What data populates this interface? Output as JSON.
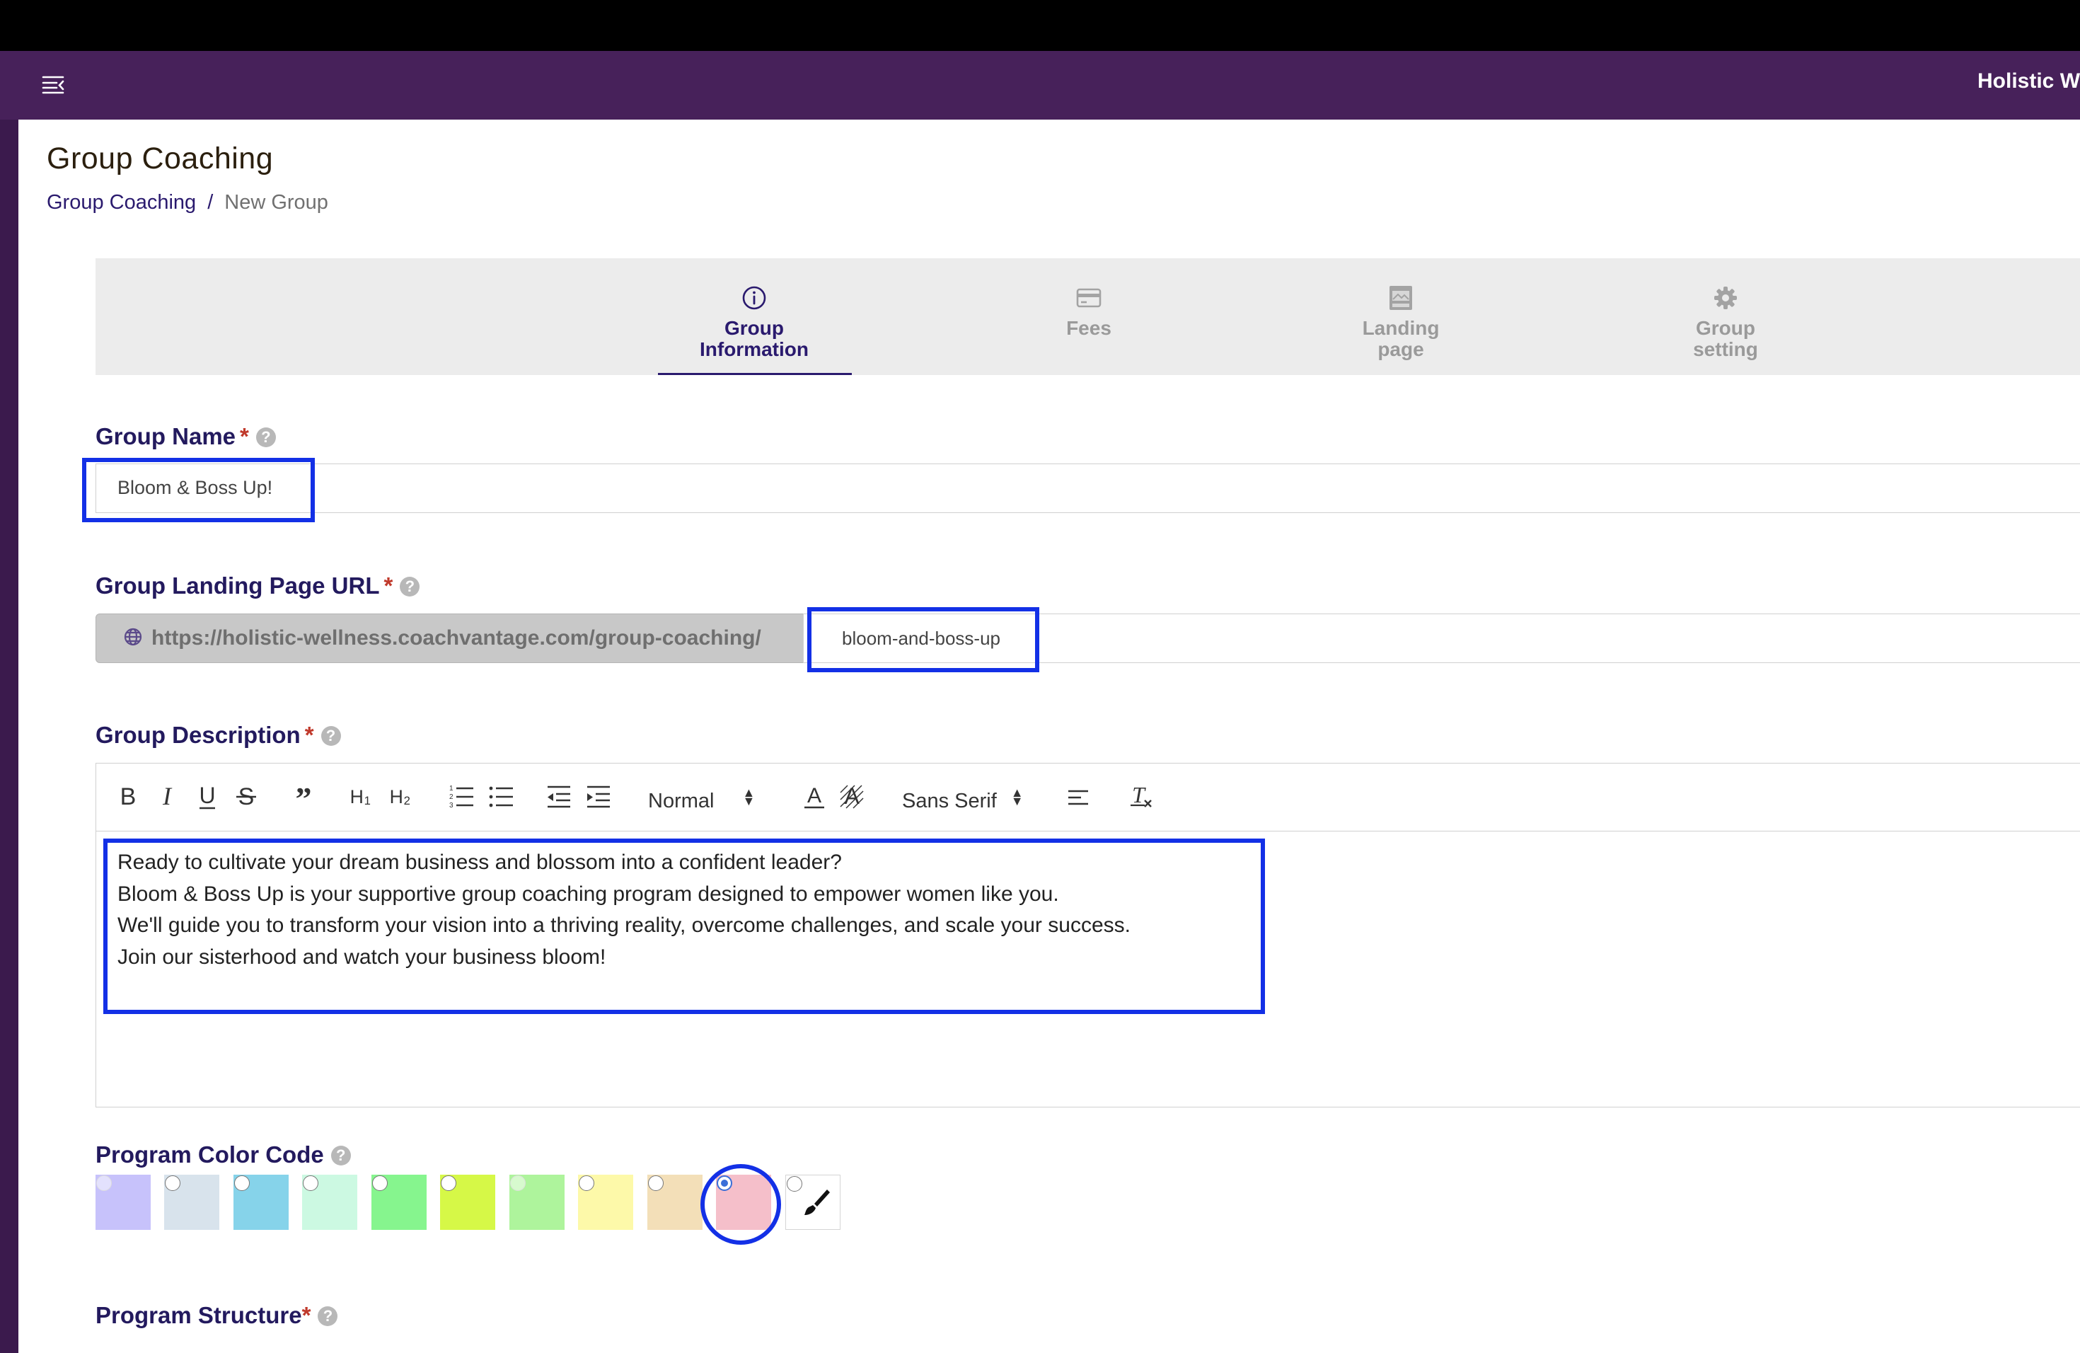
{
  "header": {
    "brand_text": "Holistic W",
    "menu_icon": "menu-collapse-icon",
    "background_color": "#47215a"
  },
  "page": {
    "title": "Group Coaching",
    "breadcrumb": {
      "link": "Group Coaching",
      "separator": "/",
      "current": "New Group"
    }
  },
  "tabs": [
    {
      "label_line1": "Group",
      "label_line2": "Information",
      "icon": "info-icon",
      "active": true
    },
    {
      "label_line1": "Fees",
      "label_line2": "",
      "icon": "credit-card-icon",
      "active": false
    },
    {
      "label_line1": "Landing",
      "label_line2": "page",
      "icon": "webpage-icon",
      "active": false
    },
    {
      "label_line1": "Group",
      "label_line2": "setting",
      "icon": "gear-icon",
      "active": false
    }
  ],
  "form": {
    "group_name": {
      "label": "Group Name",
      "required": "*",
      "help": "?",
      "value": "Bloom & Boss Up!"
    },
    "landing_url": {
      "label": "Group Landing Page URL",
      "required": "*",
      "help": "?",
      "prefix": "https://holistic-wellness.coachvantage.com/group-coaching/",
      "value": "bloom-and-boss-up"
    },
    "description": {
      "label": "Group Description",
      "required": "*",
      "help": "?",
      "toolbar": {
        "heading_select": "Normal",
        "font_select": "Sans Serif"
      },
      "lines": [
        "Ready to cultivate your dream business and blossom into a confident leader?",
        "Bloom & Boss Up is your supportive group coaching program designed to empower women like you.",
        "We'll guide you to transform your vision into a thriving reality, overcome challenges, and scale your success.",
        "Join our sisterhood and watch your business bloom!"
      ]
    },
    "color_code": {
      "label": "Program Color Code",
      "help": "?",
      "colors": [
        "#c7c2fb",
        "#d8e3ec",
        "#86d3ea",
        "#ccf9e2",
        "#86f58e",
        "#d6f847",
        "#aef49c",
        "#fdf9a9",
        "#f3dfb8",
        "#f5bfca"
      ],
      "selected": "#f5bfca",
      "custom_icon": "paintbrush-icon"
    },
    "program_structure": {
      "label": "Program Structure",
      "required": "*",
      "help": "?"
    }
  },
  "annotation_color": "#1330e6"
}
